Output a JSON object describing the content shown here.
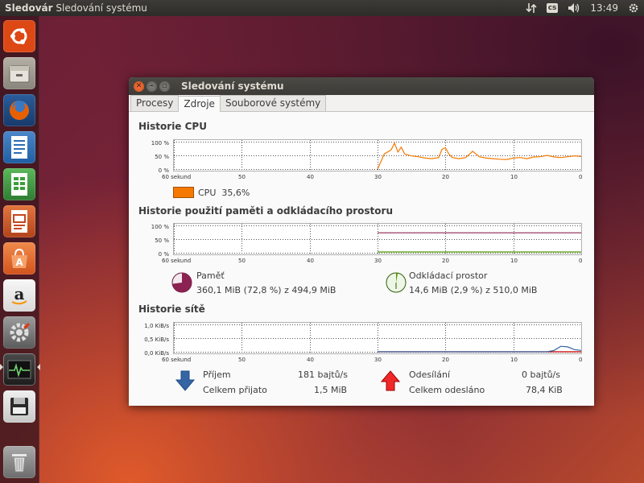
{
  "top_panel": {
    "app_name": "Sledovár",
    "window_title": "Sledování systému",
    "keyboard_layout": "cs",
    "clock": "13:49"
  },
  "launcher": {
    "items": [
      {
        "name": "ubuntu-dash-icon",
        "color": "#dd4814"
      },
      {
        "name": "files-icon",
        "color": "#9a958c"
      },
      {
        "name": "firefox-icon",
        "color": "#e66000"
      },
      {
        "name": "writer-icon",
        "color": "#2a6db3"
      },
      {
        "name": "calc-icon",
        "color": "#3b9e3b"
      },
      {
        "name": "impress-icon",
        "color": "#c4471f"
      },
      {
        "name": "software-center-icon",
        "color": "#e8692c"
      },
      {
        "name": "amazon-icon",
        "color": "#f2f1f0"
      },
      {
        "name": "system-settings-icon",
        "color": "#8a8a8a"
      },
      {
        "name": "system-monitor-icon",
        "color": "#2c2c2c"
      },
      {
        "name": "disk-icon",
        "color": "#e8e8e8"
      },
      {
        "name": "trash-icon",
        "color": "#9a9a9a"
      }
    ]
  },
  "window": {
    "title": "Sledování systému",
    "tabs": [
      {
        "label": "Procesy",
        "active": false
      },
      {
        "label": "Zdroje",
        "active": true
      },
      {
        "label": "Souborové systémy",
        "active": false
      }
    ]
  },
  "cpu": {
    "title": "Historie CPU",
    "y_labels": [
      "100 %",
      "50 %",
      "0 %"
    ],
    "x_labels": [
      "60 sekund",
      "50",
      "40",
      "30",
      "20",
      "10",
      "0"
    ],
    "legend_label": "CPU",
    "legend_value": "35,6%",
    "color": "#f57900"
  },
  "memory": {
    "title": "Historie použití paměti a odkládacího prostoru",
    "y_labels": [
      "100 %",
      "50 %",
      "0 %"
    ],
    "x_labels": [
      "60 sekund",
      "50",
      "40",
      "30",
      "20",
      "10",
      "0"
    ],
    "mem_label": "Paměť",
    "mem_value": "360,1 MiB (72,8 %) z 494,9 MiB",
    "mem_color": "#8b2252",
    "swap_label": "Odkládací prostor",
    "swap_value": "14,6 MiB (2,9 %) z 510,0 MiB",
    "swap_color": "#4e9a06"
  },
  "network": {
    "title": "Historie sítě",
    "y_labels": [
      "1,0 KiB/s",
      "0,5 KiB/s",
      "0,0 KiB/s"
    ],
    "x_labels": [
      "60 sekund",
      "50",
      "40",
      "30",
      "20",
      "10",
      "0"
    ],
    "recv_label": "Příjem",
    "recv_value": "181 bajtů/s",
    "recv_total_label": "Celkem přijato",
    "recv_total_value": "1,5 MiB",
    "send_label": "Odesílání",
    "send_value": "0 bajtů/s",
    "send_total_label": "Celkem odesláno",
    "send_total_value": "78,4 KiB",
    "recv_color": "#3465a4",
    "send_color": "#cc0000"
  },
  "chart_data": [
    {
      "type": "line",
      "title": "Historie CPU",
      "xlabel": "",
      "ylabel": "",
      "xlim": [
        60,
        0
      ],
      "ylim": [
        0,
        100
      ],
      "grid": true,
      "series": [
        {
          "name": "CPU",
          "x": [
            30,
            29,
            28,
            27.5,
            27,
            26.5,
            26,
            25,
            24,
            23,
            22,
            21,
            20.5,
            20,
            19.5,
            19,
            18,
            17,
            16,
            15,
            14,
            13,
            12,
            11,
            10,
            9,
            8,
            7,
            6,
            5,
            4,
            3,
            2,
            1,
            0
          ],
          "y": [
            0,
            55,
            70,
            95,
            62,
            80,
            55,
            48,
            45,
            40,
            38,
            42,
            72,
            78,
            55,
            42,
            38,
            42,
            65,
            45,
            40,
            38,
            36,
            35,
            40,
            42,
            38,
            44,
            45,
            50,
            44,
            42,
            45,
            48,
            46
          ]
        }
      ]
    },
    {
      "type": "line",
      "title": "Historie použití paměti a odkládacího prostoru",
      "xlabel": "",
      "ylabel": "",
      "xlim": [
        60,
        0
      ],
      "ylim": [
        0,
        100
      ],
      "grid": true,
      "series": [
        {
          "name": "Paměť",
          "x": [
            30,
            0
          ],
          "y": [
            72.8,
            72.8
          ]
        },
        {
          "name": "Odkládací prostor",
          "x": [
            30,
            0
          ],
          "y": [
            2.9,
            2.9
          ]
        }
      ]
    },
    {
      "type": "line",
      "title": "Historie sítě",
      "xlabel": "",
      "ylabel": "",
      "xlim": [
        60,
        0
      ],
      "ylim": [
        0,
        1.0
      ],
      "grid": true,
      "series": [
        {
          "name": "Příjem",
          "x": [
            30,
            5,
            4,
            3,
            2,
            1,
            0
          ],
          "y": [
            0,
            0,
            0.05,
            0.2,
            0.18,
            0.08,
            0.05
          ]
        },
        {
          "name": "Odesílání",
          "x": [
            30,
            0
          ],
          "y": [
            0,
            0
          ]
        }
      ]
    }
  ]
}
